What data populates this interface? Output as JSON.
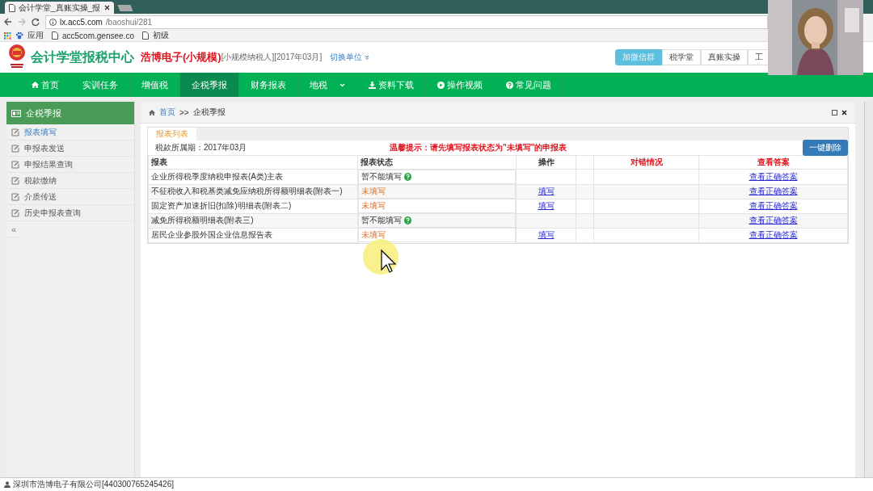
{
  "browser": {
    "tab_title": "会计学堂_真账实操_报",
    "url_host": "lx.acc5.com",
    "url_path": "/baoshui/281",
    "bookmarks": [
      {
        "label": "应用",
        "kind": "apps"
      },
      {
        "label": "acc5com.gensee.co",
        "kind": "page"
      },
      {
        "label": "初级",
        "kind": "page"
      }
    ]
  },
  "header": {
    "site_title": "会计学堂报税中心",
    "company": "浩博电子(小规模)",
    "company_info": "[小规模纳税人][2017年03月]",
    "switch_label": "切换单位",
    "top_buttons": [
      {
        "label": "加微信群",
        "highlighted": true
      },
      {
        "label": "税学堂",
        "highlighted": false
      },
      {
        "label": "真账实操",
        "highlighted": false
      },
      {
        "label": "工",
        "highlighted": false
      }
    ]
  },
  "nav": [
    {
      "label": "首页",
      "kind": "home",
      "selected": false
    },
    {
      "label": "实训任务",
      "kind": "plain",
      "selected": false
    },
    {
      "label": "增值税",
      "kind": "plain",
      "selected": false
    },
    {
      "label": "企税季报",
      "kind": "plain",
      "selected": true
    },
    {
      "label": "财务报表",
      "kind": "plain",
      "selected": false
    },
    {
      "label": "地税",
      "kind": "dropdown",
      "selected": false
    },
    {
      "label": "资料下载",
      "kind": "download",
      "selected": false
    },
    {
      "label": "操作视频",
      "kind": "play",
      "selected": false
    },
    {
      "label": "常见问题",
      "kind": "help",
      "selected": false
    }
  ],
  "sidebar": {
    "title": "企税季报",
    "items": [
      {
        "label": "报表填写",
        "selected": true
      },
      {
        "label": "申报表发送",
        "selected": false
      },
      {
        "label": "申报结果查询",
        "selected": false
      },
      {
        "label": "税款缴纳",
        "selected": false
      },
      {
        "label": "介质传送",
        "selected": false
      },
      {
        "label": "历史申报表查询",
        "selected": false
      }
    ],
    "collapse": "«"
  },
  "breadcrumb": {
    "home": "首页",
    "separator": ">>",
    "current": "企税季报"
  },
  "panel": {
    "tabs": [
      {
        "label": "报表列表",
        "selected": true
      }
    ],
    "period": "税款所属期：2017年03月",
    "tip": "温馨提示：请先填写报表状态为\"未填写\"的申报表",
    "delete_button": "一键删除",
    "columns": [
      {
        "label": "报表",
        "emphasis": false
      },
      {
        "label": "报表状态",
        "emphasis": false
      },
      {
        "label": "操作",
        "emphasis": false
      },
      {
        "label": "对错情况",
        "emphasis": true
      },
      {
        "label": "查看答案",
        "emphasis": true
      }
    ],
    "rows": [
      {
        "name": "企业所得税季度纳税申报表(A类)主表",
        "status": "暂不能填写",
        "kind": "blocked",
        "answer": "查看正确答案"
      },
      {
        "name": "不征税收入和税基类减免应纳税所得额明细表(附表一)",
        "status": "未填写",
        "kind": "unfilled",
        "action": "填写",
        "answer": "查看正确答案"
      },
      {
        "name": "固定资产加速折旧(扣除)明细表(附表二)",
        "status": "未填写",
        "kind": "unfilled",
        "action": "填写",
        "answer": "查看正确答案"
      },
      {
        "name": "减免所得税额明细表(附表三)",
        "status": "暂不能填写",
        "kind": "blocked",
        "answer": "查看正确答案"
      },
      {
        "name": "居民企业参股外国企业信息报告表",
        "status": "未填写",
        "kind": "unfilled",
        "action": "填写",
        "answer": "查看正确答案"
      }
    ]
  },
  "status_bar": "深圳市浩博电子有限公司[440300765245426]"
}
